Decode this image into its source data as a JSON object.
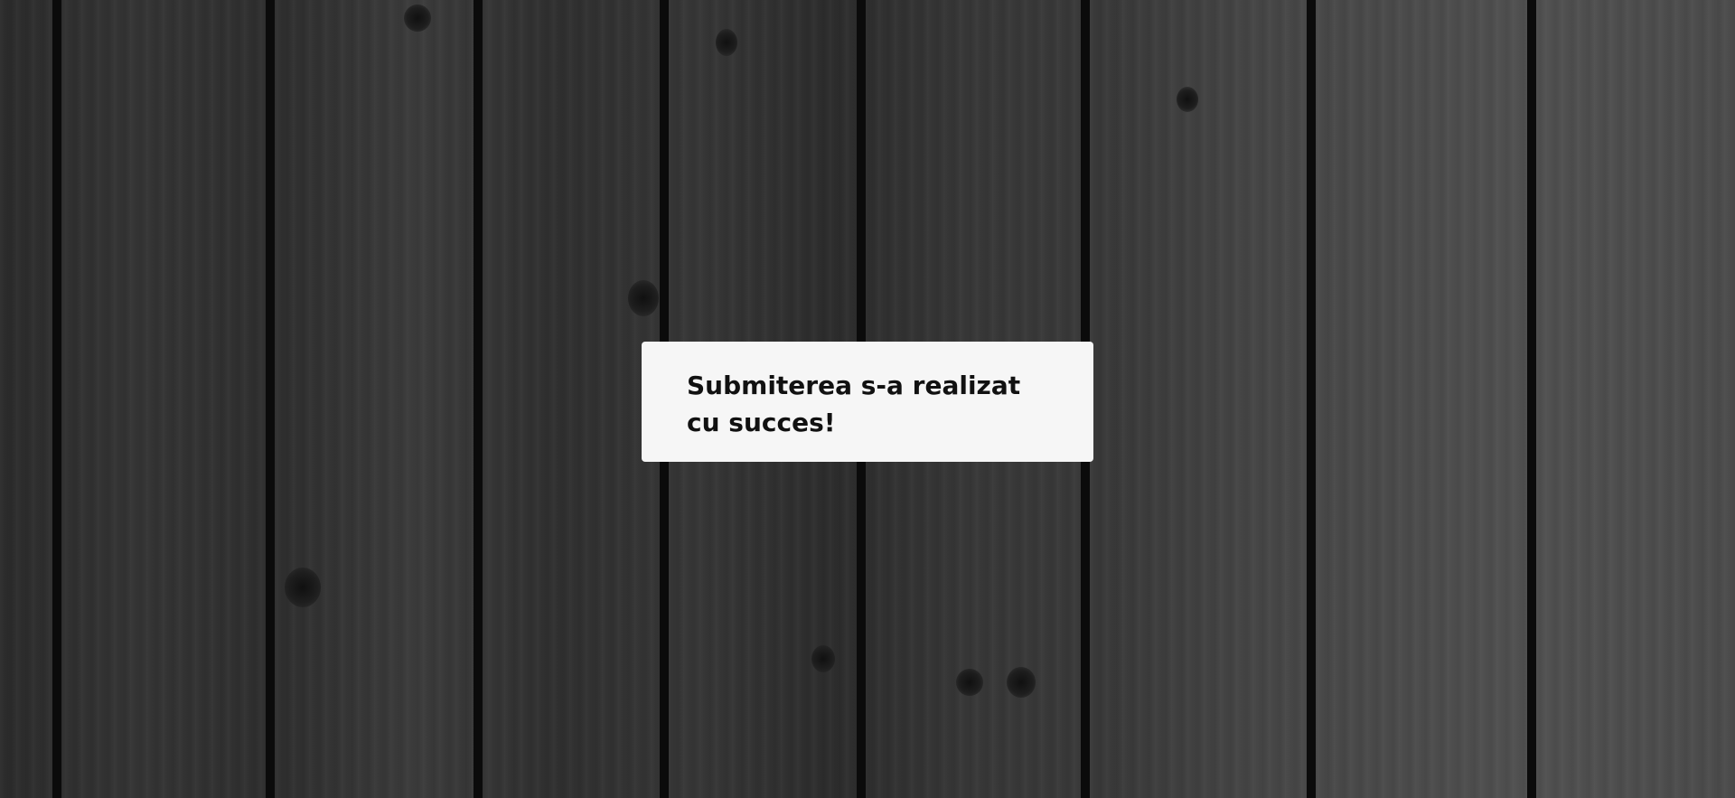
{
  "notification": {
    "message": "Submiterea s-a realizat cu succes!"
  },
  "theme": {
    "background": "#3a3a3a",
    "box_background": "#f6f6f6",
    "text_color": "#111111"
  }
}
